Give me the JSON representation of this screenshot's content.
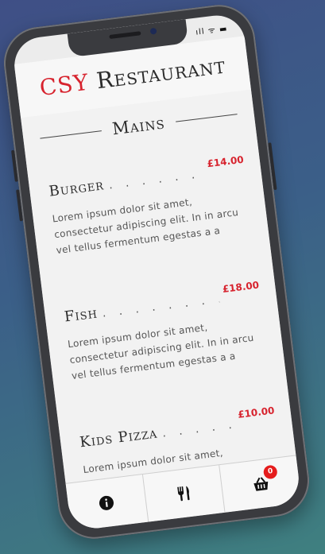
{
  "status": {
    "icons": "ıll ᯤ ▬"
  },
  "header": {
    "brand_accent": "CSY",
    "brand_rest": "Restaurant"
  },
  "section": {
    "title": "Mains"
  },
  "menu": {
    "items": [
      {
        "name": "Burger",
        "price": "£14.00",
        "description": "Lorem ipsum dolor sit amet, consectetur adipiscing elit. In in arcu vel tellus fermentum egestas a a"
      },
      {
        "name": "Fish",
        "price": "£18.00",
        "description": "Lorem ipsum dolor sit amet, consectetur adipiscing elit. In in arcu vel tellus fermentum egestas a a"
      },
      {
        "name": "Kids Pizza",
        "price": "£10.00",
        "description": "Lorem ipsum dolor sit amet, consectetur adipiscing elit. In in arcu vel tellus fermentum egestas a a"
      }
    ]
  },
  "tabbar": {
    "tabs": [
      {
        "icon": "info-icon"
      },
      {
        "icon": "cutlery-icon"
      },
      {
        "icon": "basket-icon",
        "badge": "0"
      }
    ]
  },
  "colors": {
    "accent": "#d7232e",
    "badge": "#e51c1c"
  }
}
